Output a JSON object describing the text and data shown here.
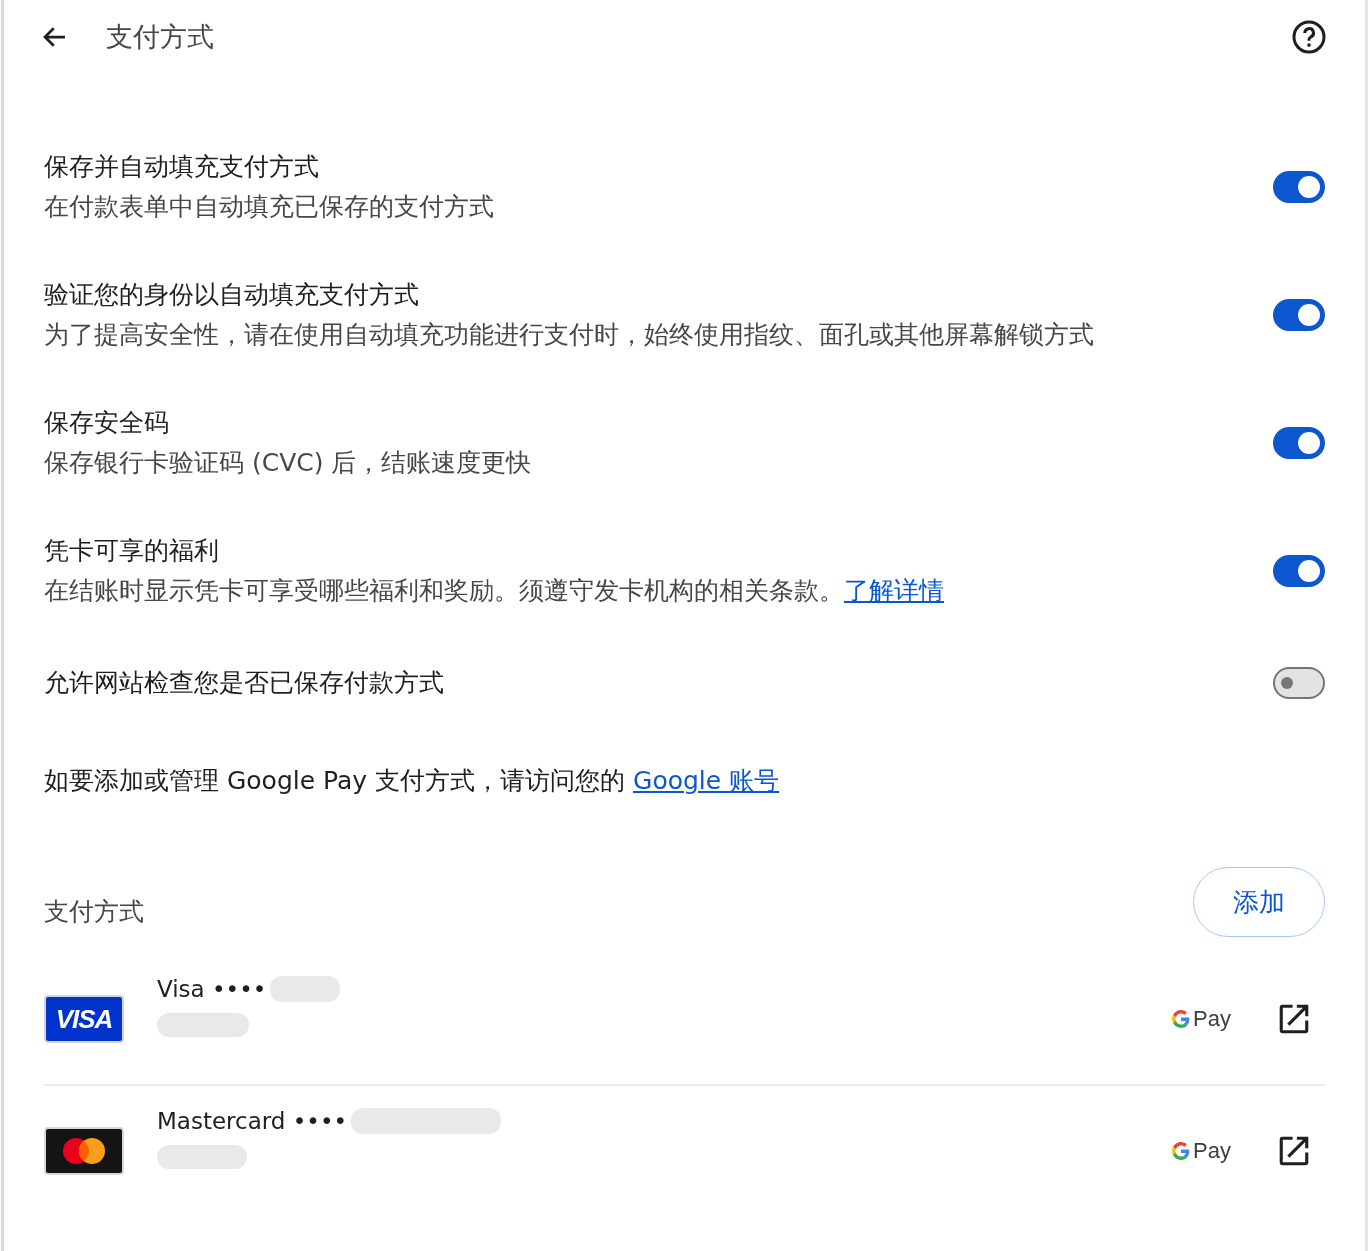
{
  "header": {
    "title": "支付方式"
  },
  "settings": [
    {
      "title": "保存并自动填充支付方式",
      "description": "在付款表单中自动填充已保存的支付方式",
      "on": true
    },
    {
      "title": "验证您的身份以自动填充支付方式",
      "description": "为了提高安全性，请在使用自动填充功能进行支付时，始终使用指纹、面孔或其他屏幕解锁方式",
      "on": true
    },
    {
      "title": "保存安全码",
      "description": "保存银行卡验证码 (CVC) 后，结账速度更快",
      "on": true
    },
    {
      "title": "凭卡可享的福利",
      "description": "在结账时显示凭卡可享受哪些福利和奖励。须遵守发卡机构的相关条款。",
      "link": "了解详情",
      "on": true
    },
    {
      "title": "允许网站检查您是否已保存付款方式",
      "on": false
    }
  ],
  "google_pay_note": {
    "text": "如要添加或管理 Google Pay 支付方式，请访问您的",
    "link": "Google 账号"
  },
  "payment_methods": {
    "title": "支付方式",
    "add_button": "添加",
    "cards": [
      {
        "kind": "visa",
        "logo_text": "VISA",
        "name": "Visa ••••",
        "wallet": "Pay"
      },
      {
        "kind": "mastercard",
        "name": "Mastercard ••••",
        "wallet": "Pay"
      }
    ]
  }
}
